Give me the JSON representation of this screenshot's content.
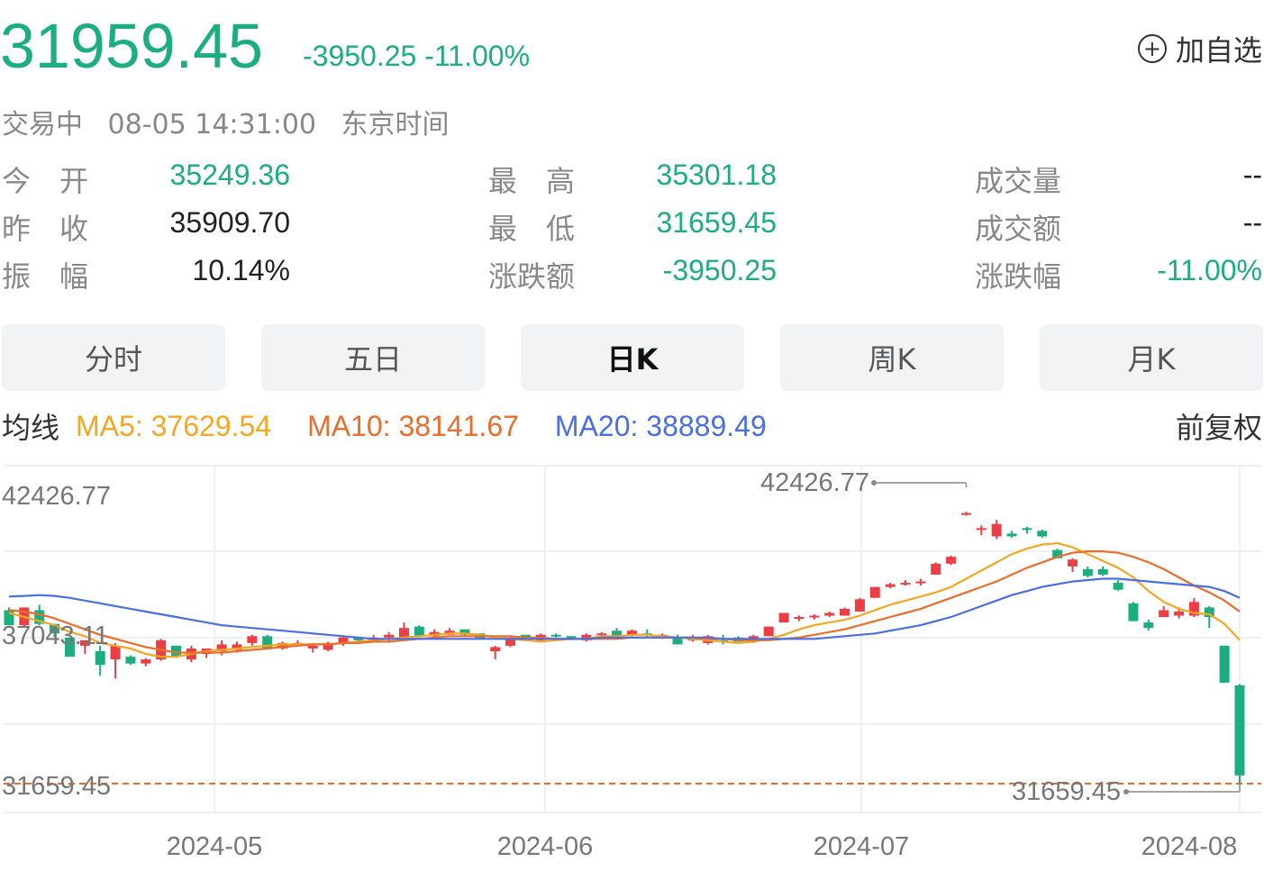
{
  "header": {
    "price": "31959.45",
    "change": "-3950.25 -11.00%",
    "watch_label": "加自选",
    "status": "交易中",
    "datetime": "08-05 14:31:00",
    "timezone": "东京时间"
  },
  "stats": [
    {
      "label": "今　开",
      "value": "35249.36",
      "color": "green"
    },
    {
      "label": "昨　收",
      "value": "35909.70",
      "color": "dark"
    },
    {
      "label": "振　幅",
      "value": "10.14%",
      "color": "dark"
    },
    {
      "label": "最　高",
      "value": "35301.18",
      "color": "green"
    },
    {
      "label": "最　低",
      "value": "31659.45",
      "color": "green"
    },
    {
      "label": "涨跌额",
      "value": "-3950.25",
      "color": "green"
    },
    {
      "label": "成交量",
      "value": "--",
      "color": "dark"
    },
    {
      "label": "成交额",
      "value": "--",
      "color": "dark"
    },
    {
      "label": "涨跌幅",
      "value": "-11.00%",
      "color": "green"
    }
  ],
  "tabs": [
    {
      "label": "分时",
      "active": false
    },
    {
      "label": "五日",
      "active": false
    },
    {
      "label": "日K",
      "active": true
    },
    {
      "label": "周K",
      "active": false
    },
    {
      "label": "月K",
      "active": false
    }
  ],
  "ma": {
    "label": "均线",
    "ma5": "MA5: 37629.54",
    "ma10": "MA10: 38141.67",
    "ma20": "MA20: 38889.49",
    "adjust": "前复权"
  },
  "colors": {
    "up": "#ec3f45",
    "down": "#1bae7f",
    "ma5": "#f5a623",
    "ma10": "#ec6d2b",
    "ma20": "#4a6fe3"
  },
  "chart_data": {
    "type": "candlestick",
    "y_tick_labels": [
      "42426.77",
      "37043.11",
      "31659.45"
    ],
    "ylim": [
      31659.45,
      42426.77
    ],
    "x_tick_labels": [
      "2024-05",
      "2024-06",
      "2024-07",
      "2024-08"
    ],
    "max_marker": "42426.77",
    "min_marker": "31659.45",
    "candles": [
      [
        38000,
        38100,
        37450,
        37450
      ],
      [
        37450,
        38100,
        37400,
        38100
      ],
      [
        38000,
        38200,
        37450,
        37500
      ],
      [
        37500,
        37500,
        37000,
        37150
      ],
      [
        37000,
        37000,
        36300,
        36300
      ],
      [
        36700,
        36900,
        36400,
        36900
      ],
      [
        36500,
        36700,
        35600,
        36000
      ],
      [
        36200,
        36800,
        35500,
        36700
      ],
      [
        36300,
        36350,
        36000,
        36050
      ],
      [
        36050,
        36250,
        35950,
        36200
      ],
      [
        36200,
        36950,
        36150,
        36900
      ],
      [
        36700,
        36700,
        36250,
        36300
      ],
      [
        36200,
        36700,
        36100,
        36600
      ],
      [
        36400,
        36600,
        36250,
        36600
      ],
      [
        36500,
        36900,
        36350,
        36750
      ],
      [
        36550,
        36850,
        36450,
        36750
      ],
      [
        36800,
        37100,
        36700,
        37050
      ],
      [
        37050,
        37100,
        36550,
        36600
      ],
      [
        36600,
        36850,
        36550,
        36800
      ],
      [
        36800,
        36900,
        36700,
        36800
      ],
      [
        36600,
        36800,
        36450,
        36700
      ],
      [
        36550,
        36850,
        36500,
        36800
      ],
      [
        36800,
        37050,
        36700,
        37000
      ],
      [
        37000,
        37000,
        36850,
        36900
      ],
      [
        36900,
        37100,
        36850,
        37000
      ],
      [
        37000,
        37200,
        36850,
        37100
      ],
      [
        37000,
        37550,
        36950,
        37350
      ],
      [
        37400,
        37450,
        37000,
        37050
      ],
      [
        37050,
        37300,
        36950,
        37200
      ],
      [
        37100,
        37350,
        37100,
        37250
      ],
      [
        37300,
        37300,
        37050,
        37100
      ],
      [
        37150,
        37150,
        36950,
        36950
      ],
      [
        36500,
        36700,
        36200,
        36650
      ],
      [
        36700,
        37000,
        36650,
        37000
      ],
      [
        37100,
        37100,
        36900,
        36900
      ],
      [
        36900,
        37150,
        36850,
        37100
      ],
      [
        37100,
        37150,
        37000,
        37050
      ],
      [
        37050,
        37050,
        36900,
        36950
      ],
      [
        36900,
        37150,
        36850,
        37100
      ],
      [
        37100,
        37200,
        37050,
        37150
      ],
      [
        37250,
        37350,
        37050,
        37050
      ],
      [
        37100,
        37300,
        37050,
        37250
      ],
      [
        37150,
        37300,
        37000,
        37100
      ],
      [
        37000,
        37150,
        36950,
        37100
      ],
      [
        37000,
        37100,
        36750,
        36750
      ],
      [
        36900,
        37100,
        36850,
        37000
      ],
      [
        36800,
        37100,
        36750,
        37050
      ],
      [
        36900,
        37100,
        36750,
        36850
      ],
      [
        37000,
        37050,
        36850,
        36850
      ],
      [
        36900,
        37100,
        36800,
        37050
      ],
      [
        37050,
        37400,
        37050,
        37400
      ],
      [
        37550,
        37900,
        37550,
        37900
      ],
      [
        37700,
        37800,
        37600,
        37750
      ],
      [
        37800,
        37850,
        37650,
        37800
      ],
      [
        37800,
        37950,
        37750,
        37900
      ],
      [
        37800,
        38100,
        37800,
        38050
      ],
      [
        37950,
        38450,
        37950,
        38400
      ],
      [
        38450,
        38850,
        38450,
        38850
      ],
      [
        38850,
        39000,
        38800,
        38950
      ],
      [
        39000,
        39100,
        38900,
        39000
      ],
      [
        39000,
        39150,
        38900,
        39050
      ],
      [
        39300,
        39750,
        39300,
        39700
      ],
      [
        39700,
        40000,
        39650,
        39950
      ],
      [
        41500,
        41600,
        41450,
        41550
      ],
      [
        41000,
        41100,
        40750,
        41000
      ],
      [
        40700,
        41300,
        40600,
        41150
      ],
      [
        40800,
        40900,
        40650,
        40700
      ],
      [
        41000,
        41050,
        40800,
        40950
      ],
      [
        40900,
        40950,
        40650,
        40700
      ],
      [
        40200,
        40250,
        39900,
        39900
      ],
      [
        39600,
        39900,
        39400,
        39850
      ],
      [
        39500,
        39600,
        39200,
        39250
      ],
      [
        39500,
        39600,
        39250,
        39300
      ],
      [
        39000,
        39100,
        38700,
        38750
      ],
      [
        38250,
        38300,
        37600,
        37600
      ],
      [
        37550,
        37650,
        37250,
        37350
      ],
      [
        37750,
        38150,
        37750,
        38000
      ],
      [
        37800,
        38100,
        37700,
        37950
      ],
      [
        37800,
        38450,
        37750,
        38300
      ],
      [
        38100,
        38150,
        37350,
        37750
      ],
      [
        36700,
        36700,
        35350,
        35350
      ],
      [
        35249.36,
        35301.18,
        31659.45,
        31959.45
      ]
    ],
    "series": [
      {
        "name": "MA5",
        "values": [
          37900,
          37750,
          37600,
          37450,
          37200,
          37050,
          36800,
          36700,
          36600,
          36400,
          36300,
          36300,
          36400,
          36500,
          36550,
          36600,
          36650,
          36700,
          36750,
          36750,
          36750,
          36750,
          36800,
          36850,
          36900,
          36950,
          37000,
          37050,
          37100,
          37150,
          37150,
          37100,
          37000,
          36950,
          36900,
          36850,
          36900,
          36950,
          36950,
          37050,
          37050,
          37100,
          37100,
          37050,
          37000,
          36950,
          36900,
          36850,
          36800,
          36850,
          36950,
          37100,
          37300,
          37450,
          37550,
          37650,
          37800,
          38000,
          38200,
          38350,
          38500,
          38650,
          38850,
          39150,
          39450,
          39750,
          40050,
          40250,
          40400,
          40450,
          40300,
          40050,
          39800,
          39550,
          39200,
          38700,
          38300,
          38050,
          37900,
          37850,
          37500,
          36900
        ]
      },
      {
        "name": "MA10",
        "values": [
          38000,
          37950,
          37850,
          37700,
          37500,
          37300,
          37100,
          36950,
          36800,
          36650,
          36550,
          36450,
          36450,
          36450,
          36450,
          36500,
          36550,
          36600,
          36650,
          36700,
          36750,
          36750,
          36800,
          36800,
          36850,
          36850,
          36900,
          36950,
          37000,
          37050,
          37050,
          37050,
          37050,
          37050,
          37000,
          37000,
          36950,
          36950,
          36950,
          36950,
          36950,
          37000,
          37000,
          37000,
          37000,
          37000,
          36950,
          36950,
          36900,
          36900,
          36900,
          36950,
          37000,
          37100,
          37200,
          37300,
          37450,
          37600,
          37750,
          37900,
          38050,
          38250,
          38450,
          38650,
          38850,
          39050,
          39300,
          39550,
          39750,
          39950,
          40100,
          40150,
          40150,
          40100,
          39950,
          39750,
          39500,
          39200,
          38900,
          38650,
          38350,
          37950
        ]
      },
      {
        "name": "MA20",
        "values": [
          38500,
          38520,
          38550,
          38520,
          38450,
          38350,
          38250,
          38150,
          38050,
          37950,
          37850,
          37750,
          37650,
          37550,
          37450,
          37400,
          37350,
          37300,
          37250,
          37200,
          37150,
          37100,
          37050,
          37000,
          36950,
          36950,
          36950,
          36950,
          36950,
          36950,
          36950,
          36950,
          36950,
          36950,
          36950,
          36950,
          36950,
          36950,
          36950,
          37000,
          37000,
          37000,
          37000,
          37000,
          37000,
          37000,
          37000,
          36950,
          36950,
          36950,
          36950,
          36950,
          36950,
          36950,
          37000,
          37050,
          37100,
          37150,
          37250,
          37350,
          37450,
          37600,
          37750,
          37950,
          38150,
          38350,
          38550,
          38700,
          38850,
          38950,
          39050,
          39100,
          39150,
          39150,
          39100,
          39050,
          39000,
          38950,
          38900,
          38850,
          38700,
          38450
        ]
      }
    ]
  }
}
